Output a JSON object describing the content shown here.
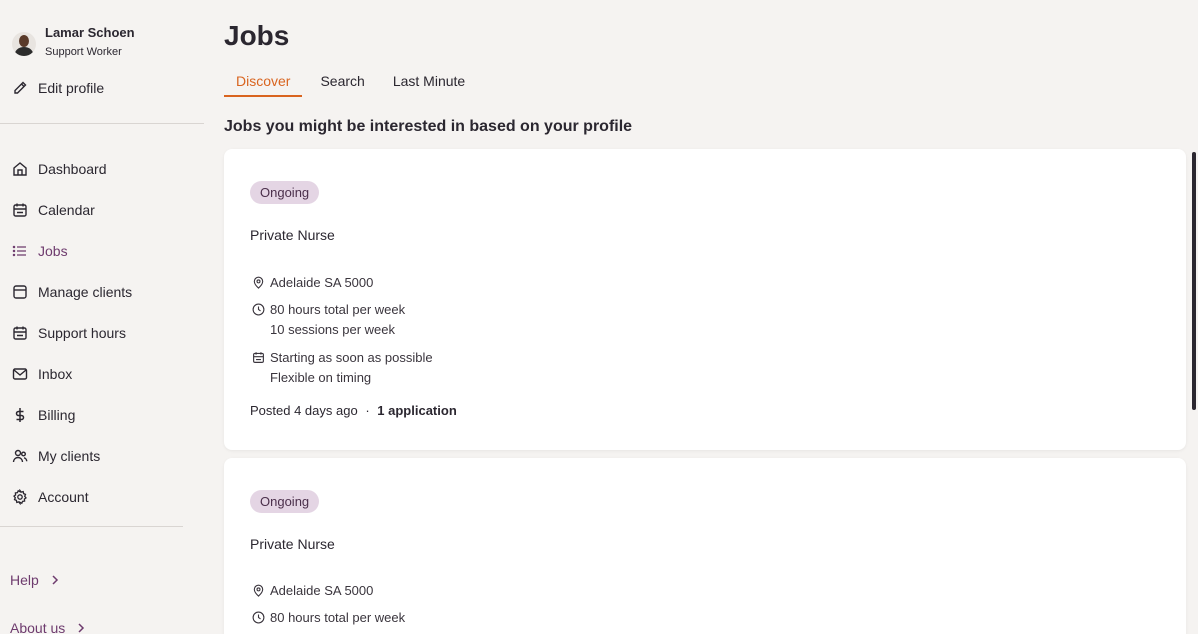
{
  "user": {
    "name": "Lamar Schoen",
    "role": "Support Worker",
    "edit_label": "Edit profile"
  },
  "nav": {
    "dashboard": "Dashboard",
    "calendar": "Calendar",
    "jobs": "Jobs",
    "manage_clients": "Manage clients",
    "support_hours": "Support hours",
    "inbox": "Inbox",
    "billing": "Billing",
    "my_clients": "My clients",
    "account": "Account"
  },
  "footer": {
    "help": "Help",
    "about": "About us"
  },
  "page": {
    "title": "Jobs",
    "tabs": {
      "discover": "Discover",
      "search": "Search",
      "last_minute": "Last Minute"
    },
    "section_title": "Jobs you might be interested in based on your profile"
  },
  "jobs": [
    {
      "badge": "Ongoing",
      "title": "Private Nurse",
      "location": "Adelaide SA 5000",
      "hours": "80 hours total per week",
      "sessions": "10 sessions per week",
      "start": "Starting as soon as possible",
      "flex": "Flexible on timing",
      "posted": "Posted 4 days ago",
      "separator": "·",
      "applications": "1 application"
    },
    {
      "badge": "Ongoing",
      "title": "Private Nurse",
      "location": "Adelaide SA 5000",
      "hours": "80 hours total per week"
    }
  ],
  "colors": {
    "accent": "#d9641f",
    "brand": "#6e3b6e",
    "badge_bg": "#e4d5e4",
    "background": "#f5f3f1"
  }
}
